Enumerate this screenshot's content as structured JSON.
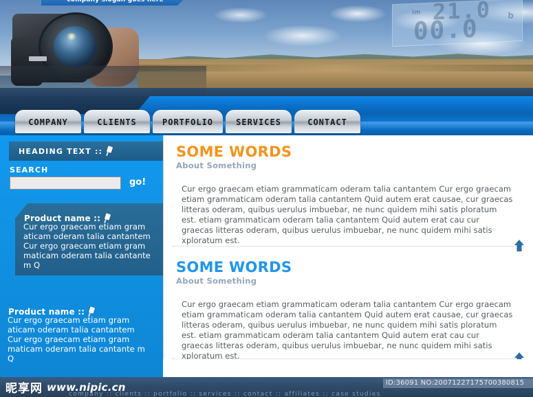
{
  "banner": {
    "slogan": "company slogan goes here",
    "lcd": {
      "small_left": "im",
      "small_right": "b",
      "line1": "21.0",
      "line2": "00.0"
    }
  },
  "nav": {
    "items": [
      {
        "label": "COMPANY",
        "name": "nav-company"
      },
      {
        "label": "CLIENTS",
        "name": "nav-clients"
      },
      {
        "label": "PORTFOLIO",
        "name": "nav-portfolio"
      },
      {
        "label": "SERVICES",
        "name": "nav-services"
      },
      {
        "label": "CONTACT",
        "name": "nav-contact"
      }
    ]
  },
  "sidebar": {
    "heading": "HEADING TEXT ::",
    "search": {
      "label": "SEARCH",
      "value": "",
      "placeholder": "",
      "go_label": "go!"
    },
    "products": [
      {
        "title": "Product name ::",
        "body": "Cur ergo graecam etiam gram aticam oderam talia cantantem Cur ergo graecam etiam gram maticam oderam talia cantante m Q"
      },
      {
        "title": "Product name ::",
        "body": "Cur ergo graecam etiam gram aticam oderam talia cantantem Cur ergo graecam etiam gram maticam oderam talia cantante m Q"
      }
    ]
  },
  "main": {
    "sections": [
      {
        "title": "SOME WORDS",
        "subtitle": "About Something",
        "color": "#f2941f",
        "body": "Cur ergo graecam etiam grammaticam oderam talia cantantem Cur ergo graecam etiam grammaticam oderam talia cantantem Quid autem erat causae, cur graecas litteras oderam, quibus uerulus imbuebar, ne nunc quidem mihi satis ploratum est.  etiam grammaticam oderam talia cantantem Quid autem erat cau cur graecas litteras oderam, quibus uerulus imbuebar, ne nunc quidem mihi satis xploratum est."
      },
      {
        "title": "SOME WORDS",
        "subtitle": "About Something",
        "color": "#2196e8",
        "body": "Cur ergo graecam etiam grammaticam oderam talia cantantem Cur ergo graecam etiam grammaticam oderam talia cantantem Quid autem erat causae, cur graecas litteras oderam, quibus uerulus imbuebar, ne nunc quidem mihi satis ploratum est.  etiam grammaticam oderam talia cantantem Quid autem erat cau cur graecas litteras oderam, quibus uerulus imbuebar, ne nunc quidem mihi satis xploratum est."
      }
    ]
  },
  "footer": {
    "watermark_cn": "昵享网",
    "watermark_url": "www.nipic.cn",
    "links": "company :: clients :: portfolio :: services :: contact :: affiliates :: case studies",
    "id_badge": "ID:36091 NO:20071227175700380815"
  },
  "colors": {
    "accent_blue": "#1199ef",
    "nav_blue": "#0b74cf",
    "heading_orange": "#f2941f",
    "heading_blue": "#2196e8",
    "footer_navy": "#2f4a68"
  }
}
